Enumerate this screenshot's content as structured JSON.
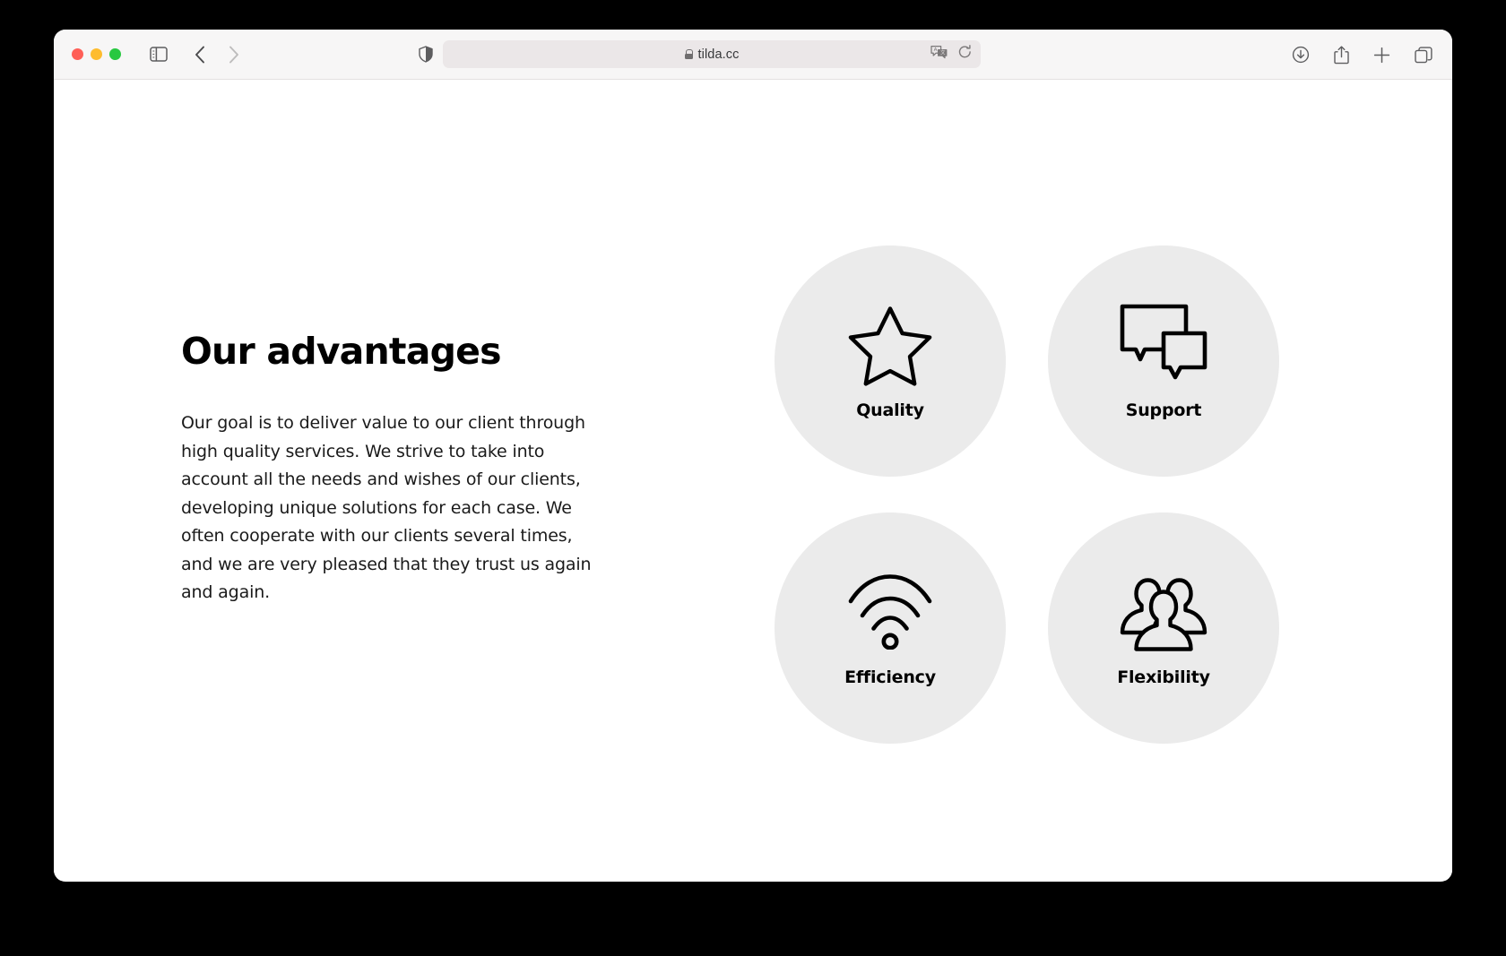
{
  "browser": {
    "traffic_lights": [
      {
        "name": "close",
        "color": "#ff5f57"
      },
      {
        "name": "minimize",
        "color": "#febc2e"
      },
      {
        "name": "zoom",
        "color": "#28c840"
      }
    ],
    "sidebar_button": "sidebar-icon",
    "back_button": "chevron-left-icon",
    "forward_button": "chevron-right-icon",
    "shield_button": "shield-icon",
    "address_bar": {
      "url": "tilda.cc",
      "lock": "lock-icon",
      "translate": "translate-icon",
      "reload": "reload-icon"
    },
    "right_buttons": [
      {
        "name": "downloads-icon"
      },
      {
        "name": "share-icon"
      },
      {
        "name": "new-tab-icon"
      },
      {
        "name": "tab-overview-icon"
      }
    ]
  },
  "page": {
    "title": "Our advantages",
    "body": "Our goal is to deliver value to our client through high quality services. We strive to take into account all the needs and wishes of our clients, developing unique solutions for each case. We often cooperate with our clients several times, and we are very pleased that they trust us again and again.",
    "circle_color": "#ebebeb",
    "background_color": "#ffffff",
    "text_color": "#000000",
    "cards": [
      {
        "label": "Quality",
        "icon": "star-icon"
      },
      {
        "label": "Support",
        "icon": "speech-bubbles-icon"
      },
      {
        "label": "Efficiency",
        "icon": "wifi-icon"
      },
      {
        "label": "Flexibility",
        "icon": "people-group-icon"
      }
    ]
  }
}
